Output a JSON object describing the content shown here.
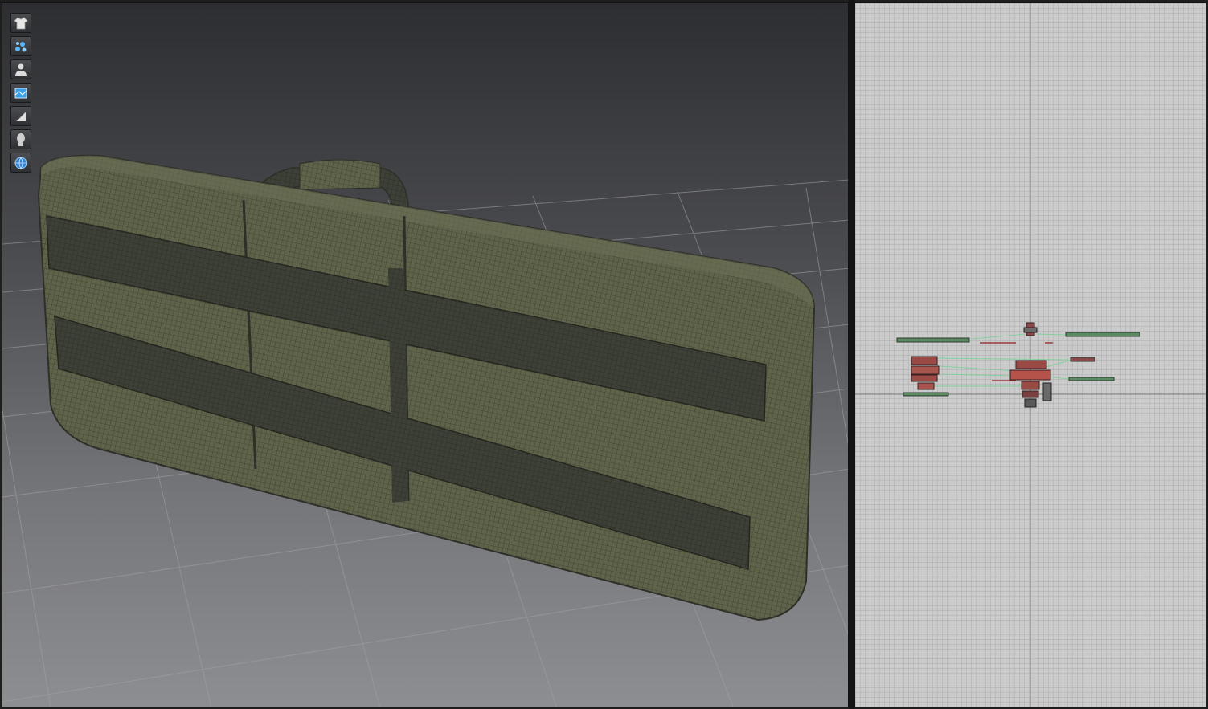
{
  "colors": {
    "fabric": "#5f634a",
    "fabric_dark": "#44473a",
    "strap": "#3a3d33",
    "pattern_red": "#9a3a3a",
    "pattern_green": "#7fd09a",
    "viewport_2d_bg": "#cbcbcb"
  },
  "toolbar": {
    "tools": [
      {
        "icon": "garment-icon"
      },
      {
        "icon": "particles-icon"
      },
      {
        "icon": "avatar-icon"
      },
      {
        "icon": "texture-icon"
      },
      {
        "icon": "fabric-icon"
      },
      {
        "icon": "avatar-silhouette-icon"
      },
      {
        "icon": "environment-icon"
      }
    ]
  },
  "viewport_3d": {
    "content": "garment-3d-model"
  },
  "viewport_2d": {
    "content": "pattern-pieces"
  }
}
